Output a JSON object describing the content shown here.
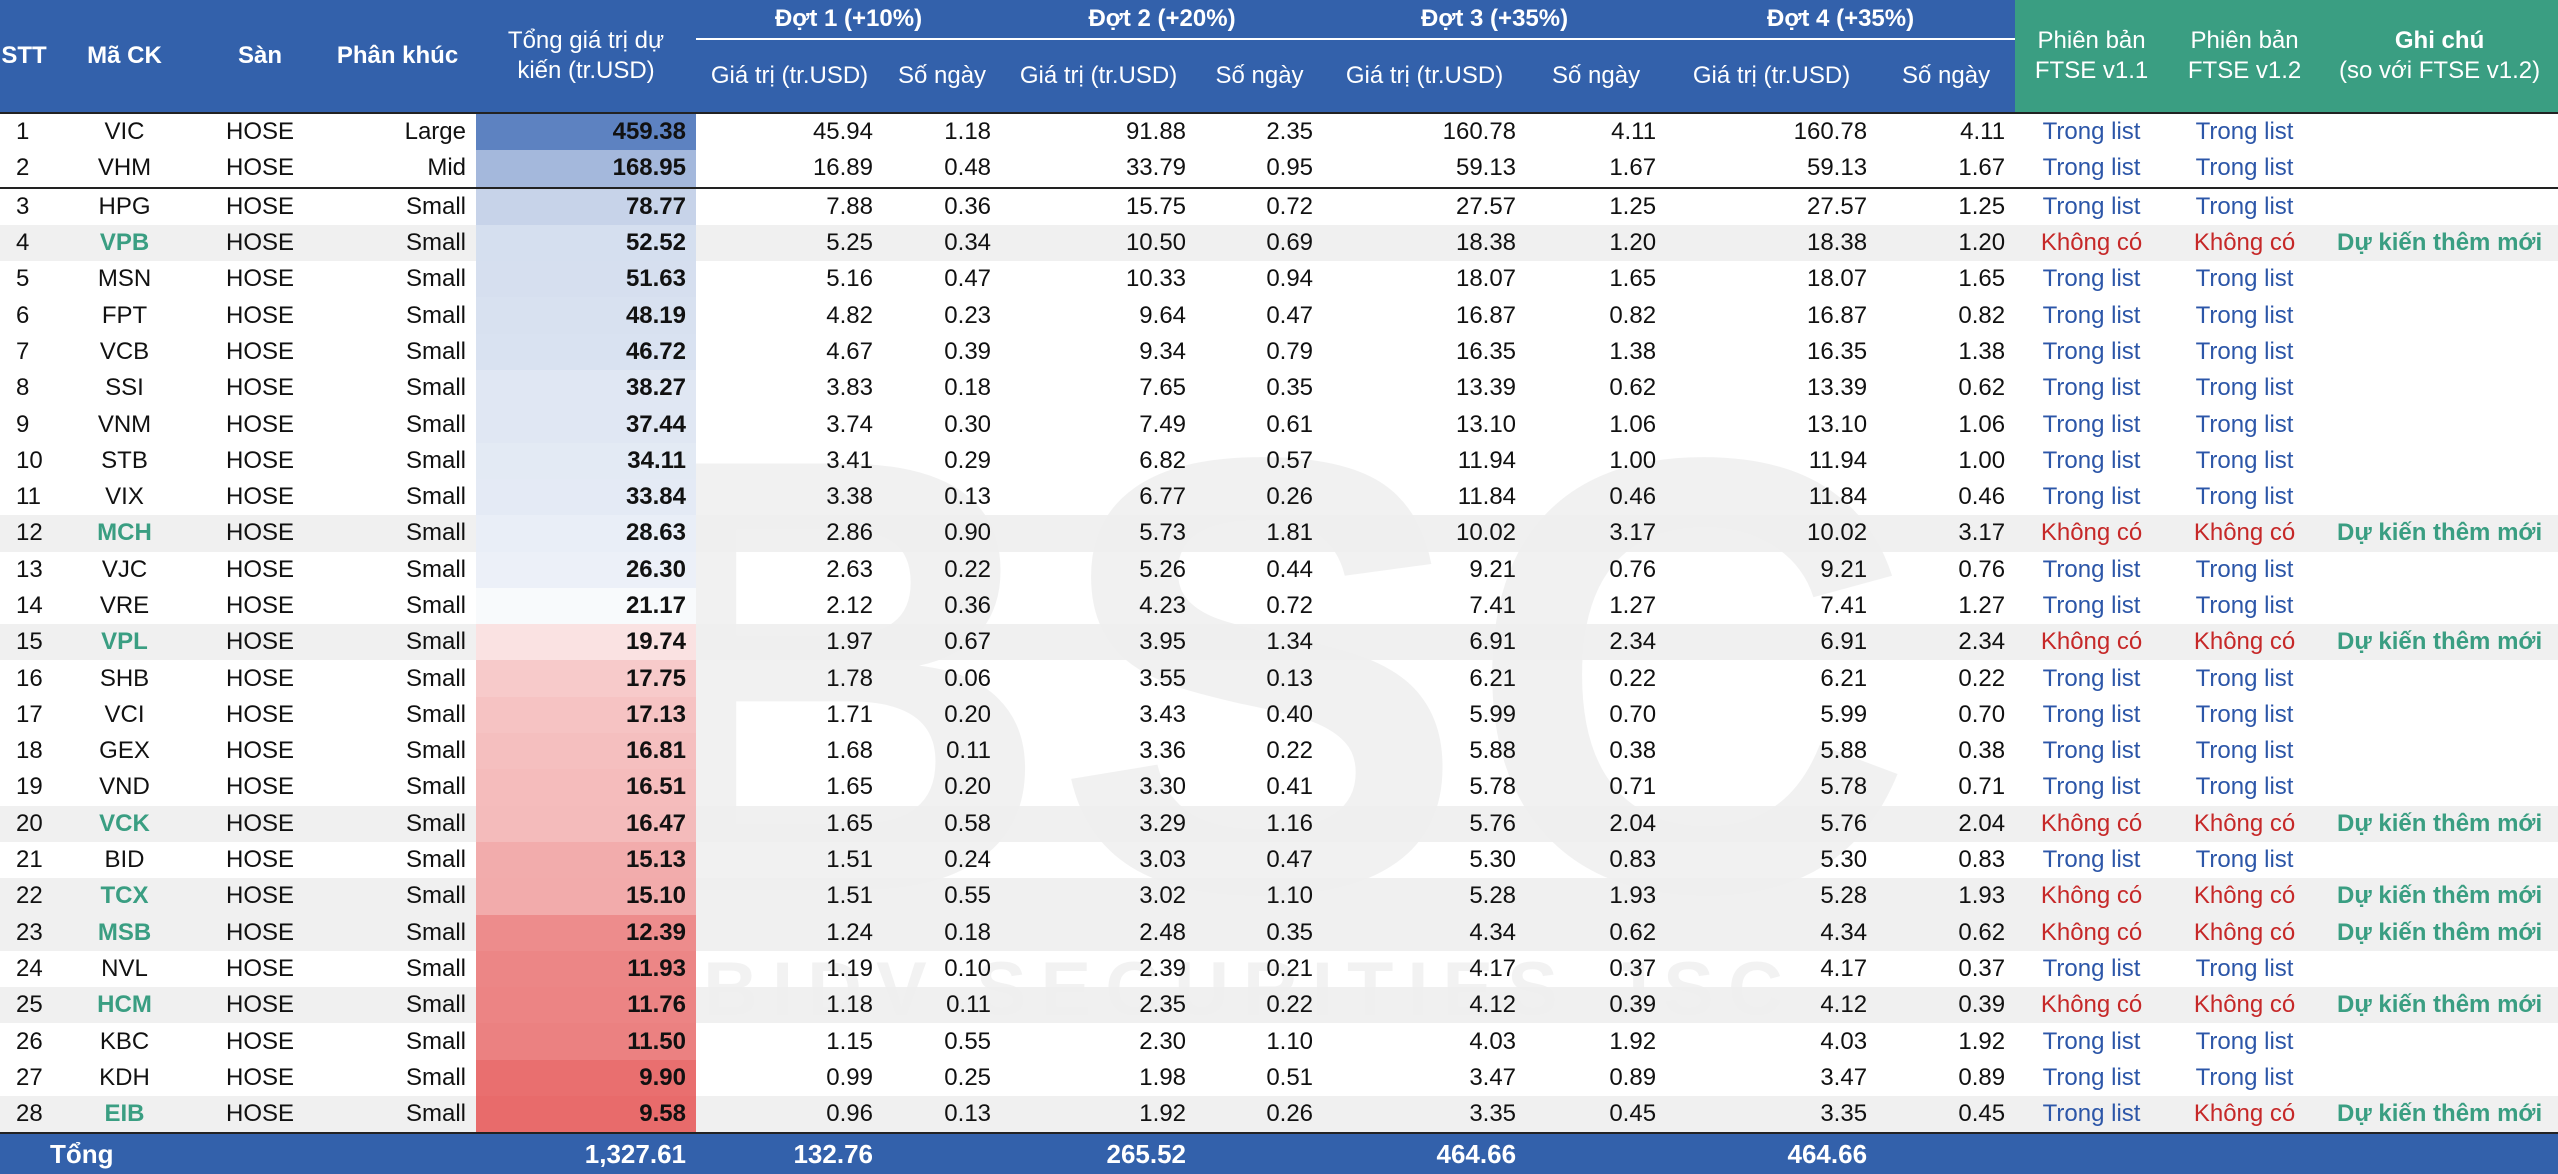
{
  "header": {
    "stt": "STT",
    "ma_ck": "Mã CK",
    "san": "Sàn",
    "phan_khuc": "Phân khúc",
    "tong_gia_tri": "Tổng giá trị dự kiến (tr.USD)",
    "dot1": "Đợt 1 (+10%)",
    "dot2": "Đợt 2 (+20%)",
    "dot3": "Đợt 3 (+35%)",
    "dot4": "Đợt 4 (+35%)",
    "gia_tri": "Giá trị (tr.USD)",
    "so_ngay": "Số ngày",
    "ftse11_line1": "Phiên bản",
    "ftse11_line2": "FTSE v1.1",
    "ftse12_line1": "Phiên bản",
    "ftse12_line2": "FTSE v1.2",
    "ghichu_line1": "Ghi chú",
    "ghichu_line2": "(so với FTSE v1.2)"
  },
  "colors": {
    "header_blue": "#3361ab",
    "header_green": "#3a9e82",
    "in_list_blue": "#2c56a8",
    "not_listed_red": "#c62828",
    "heat_high_blue": "#5a7fc0",
    "heat_low_red": "#e86b6b"
  },
  "rows": [
    {
      "stt": "1",
      "code": "VIC",
      "exchange": "HOSE",
      "segment": "Large",
      "total": "459.38",
      "total_num": 459.38,
      "d1v": "45.94",
      "d1d": "1.18",
      "d2v": "91.88",
      "d2d": "2.35",
      "d3v": "160.78",
      "d3d": "4.11",
      "d4v": "160.78",
      "d4d": "4.11",
      "v11": "Trong list",
      "v12": "Trong list",
      "note": "",
      "is_new": false
    },
    {
      "stt": "2",
      "code": "VHM",
      "exchange": "HOSE",
      "segment": "Mid",
      "total": "168.95",
      "total_num": 168.95,
      "d1v": "16.89",
      "d1d": "0.48",
      "d2v": "33.79",
      "d2d": "0.95",
      "d3v": "59.13",
      "d3d": "1.67",
      "d4v": "59.13",
      "d4d": "1.67",
      "v11": "Trong list",
      "v12": "Trong list",
      "note": "",
      "is_new": false
    },
    {
      "stt": "3",
      "code": "HPG",
      "exchange": "HOSE",
      "segment": "Small",
      "total": "78.77",
      "total_num": 78.77,
      "d1v": "7.88",
      "d1d": "0.36",
      "d2v": "15.75",
      "d2d": "0.72",
      "d3v": "27.57",
      "d3d": "1.25",
      "d4v": "27.57",
      "d4d": "1.25",
      "v11": "Trong list",
      "v12": "Trong list",
      "note": "",
      "is_new": false
    },
    {
      "stt": "4",
      "code": "VPB",
      "exchange": "HOSE",
      "segment": "Small",
      "total": "52.52",
      "total_num": 52.52,
      "d1v": "5.25",
      "d1d": "0.34",
      "d2v": "10.50",
      "d2d": "0.69",
      "d3v": "18.38",
      "d3d": "1.20",
      "d4v": "18.38",
      "d4d": "1.20",
      "v11": "Không có",
      "v12": "Không có",
      "note": "Dự kiến thêm mới",
      "is_new": true
    },
    {
      "stt": "5",
      "code": "MSN",
      "exchange": "HOSE",
      "segment": "Small",
      "total": "51.63",
      "total_num": 51.63,
      "d1v": "5.16",
      "d1d": "0.47",
      "d2v": "10.33",
      "d2d": "0.94",
      "d3v": "18.07",
      "d3d": "1.65",
      "d4v": "18.07",
      "d4d": "1.65",
      "v11": "Trong list",
      "v12": "Trong list",
      "note": "",
      "is_new": false
    },
    {
      "stt": "6",
      "code": "FPT",
      "exchange": "HOSE",
      "segment": "Small",
      "total": "48.19",
      "total_num": 48.19,
      "d1v": "4.82",
      "d1d": "0.23",
      "d2v": "9.64",
      "d2d": "0.47",
      "d3v": "16.87",
      "d3d": "0.82",
      "d4v": "16.87",
      "d4d": "0.82",
      "v11": "Trong list",
      "v12": "Trong list",
      "note": "",
      "is_new": false
    },
    {
      "stt": "7",
      "code": "VCB",
      "exchange": "HOSE",
      "segment": "Small",
      "total": "46.72",
      "total_num": 46.72,
      "d1v": "4.67",
      "d1d": "0.39",
      "d2v": "9.34",
      "d2d": "0.79",
      "d3v": "16.35",
      "d3d": "1.38",
      "d4v": "16.35",
      "d4d": "1.38",
      "v11": "Trong list",
      "v12": "Trong list",
      "note": "",
      "is_new": false
    },
    {
      "stt": "8",
      "code": "SSI",
      "exchange": "HOSE",
      "segment": "Small",
      "total": "38.27",
      "total_num": 38.27,
      "d1v": "3.83",
      "d1d": "0.18",
      "d2v": "7.65",
      "d2d": "0.35",
      "d3v": "13.39",
      "d3d": "0.62",
      "d4v": "13.39",
      "d4d": "0.62",
      "v11": "Trong list",
      "v12": "Trong list",
      "note": "",
      "is_new": false
    },
    {
      "stt": "9",
      "code": "VNM",
      "exchange": "HOSE",
      "segment": "Small",
      "total": "37.44",
      "total_num": 37.44,
      "d1v": "3.74",
      "d1d": "0.30",
      "d2v": "7.49",
      "d2d": "0.61",
      "d3v": "13.10",
      "d3d": "1.06",
      "d4v": "13.10",
      "d4d": "1.06",
      "v11": "Trong list",
      "v12": "Trong list",
      "note": "",
      "is_new": false
    },
    {
      "stt": "10",
      "code": "STB",
      "exchange": "HOSE",
      "segment": "Small",
      "total": "34.11",
      "total_num": 34.11,
      "d1v": "3.41",
      "d1d": "0.29",
      "d2v": "6.82",
      "d2d": "0.57",
      "d3v": "11.94",
      "d3d": "1.00",
      "d4v": "11.94",
      "d4d": "1.00",
      "v11": "Trong list",
      "v12": "Trong list",
      "note": "",
      "is_new": false
    },
    {
      "stt": "11",
      "code": "VIX",
      "exchange": "HOSE",
      "segment": "Small",
      "total": "33.84",
      "total_num": 33.84,
      "d1v": "3.38",
      "d1d": "0.13",
      "d2v": "6.77",
      "d2d": "0.26",
      "d3v": "11.84",
      "d3d": "0.46",
      "d4v": "11.84",
      "d4d": "0.46",
      "v11": "Trong list",
      "v12": "Trong list",
      "note": "",
      "is_new": false
    },
    {
      "stt": "12",
      "code": "MCH",
      "exchange": "HOSE",
      "segment": "Small",
      "total": "28.63",
      "total_num": 28.63,
      "d1v": "2.86",
      "d1d": "0.90",
      "d2v": "5.73",
      "d2d": "1.81",
      "d3v": "10.02",
      "d3d": "3.17",
      "d4v": "10.02",
      "d4d": "3.17",
      "v11": "Không có",
      "v12": "Không có",
      "note": "Dự kiến thêm mới",
      "is_new": true
    },
    {
      "stt": "13",
      "code": "VJC",
      "exchange": "HOSE",
      "segment": "Small",
      "total": "26.30",
      "total_num": 26.3,
      "d1v": "2.63",
      "d1d": "0.22",
      "d2v": "5.26",
      "d2d": "0.44",
      "d3v": "9.21",
      "d3d": "0.76",
      "d4v": "9.21",
      "d4d": "0.76",
      "v11": "Trong list",
      "v12": "Trong list",
      "note": "",
      "is_new": false
    },
    {
      "stt": "14",
      "code": "VRE",
      "exchange": "HOSE",
      "segment": "Small",
      "total": "21.17",
      "total_num": 21.17,
      "d1v": "2.12",
      "d1d": "0.36",
      "d2v": "4.23",
      "d2d": "0.72",
      "d3v": "7.41",
      "d3d": "1.27",
      "d4v": "7.41",
      "d4d": "1.27",
      "v11": "Trong list",
      "v12": "Trong list",
      "note": "",
      "is_new": false
    },
    {
      "stt": "15",
      "code": "VPL",
      "exchange": "HOSE",
      "segment": "Small",
      "total": "19.74",
      "total_num": 19.74,
      "d1v": "1.97",
      "d1d": "0.67",
      "d2v": "3.95",
      "d2d": "1.34",
      "d3v": "6.91",
      "d3d": "2.34",
      "d4v": "6.91",
      "d4d": "2.34",
      "v11": "Không có",
      "v12": "Không có",
      "note": "Dự kiến thêm mới",
      "is_new": true
    },
    {
      "stt": "16",
      "code": "SHB",
      "exchange": "HOSE",
      "segment": "Small",
      "total": "17.75",
      "total_num": 17.75,
      "d1v": "1.78",
      "d1d": "0.06",
      "d2v": "3.55",
      "d2d": "0.13",
      "d3v": "6.21",
      "d3d": "0.22",
      "d4v": "6.21",
      "d4d": "0.22",
      "v11": "Trong list",
      "v12": "Trong list",
      "note": "",
      "is_new": false
    },
    {
      "stt": "17",
      "code": "VCI",
      "exchange": "HOSE",
      "segment": "Small",
      "total": "17.13",
      "total_num": 17.13,
      "d1v": "1.71",
      "d1d": "0.20",
      "d2v": "3.43",
      "d2d": "0.40",
      "d3v": "5.99",
      "d3d": "0.70",
      "d4v": "5.99",
      "d4d": "0.70",
      "v11": "Trong list",
      "v12": "Trong list",
      "note": "",
      "is_new": false
    },
    {
      "stt": "18",
      "code": "GEX",
      "exchange": "HOSE",
      "segment": "Small",
      "total": "16.81",
      "total_num": 16.81,
      "d1v": "1.68",
      "d1d": "0.11",
      "d2v": "3.36",
      "d2d": "0.22",
      "d3v": "5.88",
      "d3d": "0.38",
      "d4v": "5.88",
      "d4d": "0.38",
      "v11": "Trong list",
      "v12": "Trong list",
      "note": "",
      "is_new": false
    },
    {
      "stt": "19",
      "code": "VND",
      "exchange": "HOSE",
      "segment": "Small",
      "total": "16.51",
      "total_num": 16.51,
      "d1v": "1.65",
      "d1d": "0.20",
      "d2v": "3.30",
      "d2d": "0.41",
      "d3v": "5.78",
      "d3d": "0.71",
      "d4v": "5.78",
      "d4d": "0.71",
      "v11": "Trong list",
      "v12": "Trong list",
      "note": "",
      "is_new": false
    },
    {
      "stt": "20",
      "code": "VCK",
      "exchange": "HOSE",
      "segment": "Small",
      "total": "16.47",
      "total_num": 16.47,
      "d1v": "1.65",
      "d1d": "0.58",
      "d2v": "3.29",
      "d2d": "1.16",
      "d3v": "5.76",
      "d3d": "2.04",
      "d4v": "5.76",
      "d4d": "2.04",
      "v11": "Không có",
      "v12": "Không có",
      "note": "Dự kiến thêm mới",
      "is_new": true
    },
    {
      "stt": "21",
      "code": "BID",
      "exchange": "HOSE",
      "segment": "Small",
      "total": "15.13",
      "total_num": 15.13,
      "d1v": "1.51",
      "d1d": "0.24",
      "d2v": "3.03",
      "d2d": "0.47",
      "d3v": "5.30",
      "d3d": "0.83",
      "d4v": "5.30",
      "d4d": "0.83",
      "v11": "Trong list",
      "v12": "Trong list",
      "note": "",
      "is_new": false
    },
    {
      "stt": "22",
      "code": "TCX",
      "exchange": "HOSE",
      "segment": "Small",
      "total": "15.10",
      "total_num": 15.1,
      "d1v": "1.51",
      "d1d": "0.55",
      "d2v": "3.02",
      "d2d": "1.10",
      "d3v": "5.28",
      "d3d": "1.93",
      "d4v": "5.28",
      "d4d": "1.93",
      "v11": "Không có",
      "v12": "Không có",
      "note": "Dự kiến thêm mới",
      "is_new": true
    },
    {
      "stt": "23",
      "code": "MSB",
      "exchange": "HOSE",
      "segment": "Small",
      "total": "12.39",
      "total_num": 12.39,
      "d1v": "1.24",
      "d1d": "0.18",
      "d2v": "2.48",
      "d2d": "0.35",
      "d3v": "4.34",
      "d3d": "0.62",
      "d4v": "4.34",
      "d4d": "0.62",
      "v11": "Không có",
      "v12": "Không có",
      "note": "Dự kiến thêm mới",
      "is_new": true
    },
    {
      "stt": "24",
      "code": "NVL",
      "exchange": "HOSE",
      "segment": "Small",
      "total": "11.93",
      "total_num": 11.93,
      "d1v": "1.19",
      "d1d": "0.10",
      "d2v": "2.39",
      "d2d": "0.21",
      "d3v": "4.17",
      "d3d": "0.37",
      "d4v": "4.17",
      "d4d": "0.37",
      "v11": "Trong list",
      "v12": "Trong list",
      "note": "",
      "is_new": false
    },
    {
      "stt": "25",
      "code": "HCM",
      "exchange": "HOSE",
      "segment": "Small",
      "total": "11.76",
      "total_num": 11.76,
      "d1v": "1.18",
      "d1d": "0.11",
      "d2v": "2.35",
      "d2d": "0.22",
      "d3v": "4.12",
      "d3d": "0.39",
      "d4v": "4.12",
      "d4d": "0.39",
      "v11": "Không có",
      "v12": "Không có",
      "note": "Dự kiến thêm mới",
      "is_new": true
    },
    {
      "stt": "26",
      "code": "KBC",
      "exchange": "HOSE",
      "segment": "Small",
      "total": "11.50",
      "total_num": 11.5,
      "d1v": "1.15",
      "d1d": "0.55",
      "d2v": "2.30",
      "d2d": "1.10",
      "d3v": "4.03",
      "d3d": "1.92",
      "d4v": "4.03",
      "d4d": "1.92",
      "v11": "Trong list",
      "v12": "Trong list",
      "note": "",
      "is_new": false
    },
    {
      "stt": "27",
      "code": "KDH",
      "exchange": "HOSE",
      "segment": "Small",
      "total": "9.90",
      "total_num": 9.9,
      "d1v": "0.99",
      "d1d": "0.25",
      "d2v": "1.98",
      "d2d": "0.51",
      "d3v": "3.47",
      "d3d": "0.89",
      "d4v": "3.47",
      "d4d": "0.89",
      "v11": "Trong list",
      "v12": "Trong list",
      "note": "",
      "is_new": false
    },
    {
      "stt": "28",
      "code": "EIB",
      "exchange": "HOSE",
      "segment": "Small",
      "total": "9.58",
      "total_num": 9.58,
      "d1v": "0.96",
      "d1d": "0.13",
      "d2v": "1.92",
      "d2d": "0.26",
      "d3v": "3.35",
      "d3d": "0.45",
      "d4v": "3.35",
      "d4d": "0.45",
      "v11": "Trong list",
      "v12": "Không có",
      "note": "Dự kiến thêm mới",
      "is_new": true
    }
  ],
  "footer": {
    "label": "Tổng",
    "total": "1,327.61",
    "d1": "132.76",
    "d2": "265.52",
    "d3": "464.66",
    "d4": "464.66"
  },
  "watermark": {
    "logo_text": "BSC",
    "subtitle": "BIDV SECURITIES JSC"
  }
}
